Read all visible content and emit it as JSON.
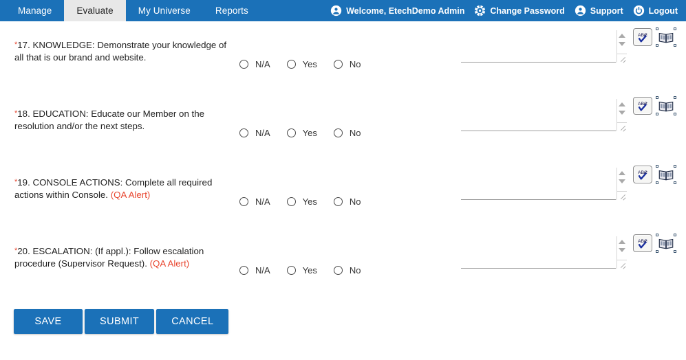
{
  "nav": {
    "tabs": [
      {
        "label": "Manage",
        "active": false
      },
      {
        "label": "Evaluate",
        "active": true
      },
      {
        "label": "My Universe",
        "active": false
      },
      {
        "label": "Reports",
        "active": false
      }
    ],
    "links": [
      {
        "label": "Welcome, EtechDemo Admin",
        "icon": "user-icon"
      },
      {
        "label": "Change Password",
        "icon": "gear-icon"
      },
      {
        "label": "Support",
        "icon": "user-icon"
      },
      {
        "label": "Logout",
        "icon": "power-icon"
      }
    ]
  },
  "colors": {
    "brand_blue": "#1b71b8",
    "active_tab_bg": "#e8e8e8",
    "alert_red": "#e8462f",
    "text": "#222222"
  },
  "questions": [
    {
      "required_marker": "*",
      "number": "17.",
      "title": "KNOWLEDGE:",
      "body": " Demonstrate your knowledge of all that is our brand and website.",
      "alert": "",
      "options": [
        "N/A",
        "Yes",
        "No"
      ],
      "selected": "",
      "comment": "",
      "comment_placeholder": ""
    },
    {
      "required_marker": "*",
      "number": "18.",
      "title": "EDUCATION:",
      "body": " Educate our Member on the resolution and/or the next steps.",
      "alert": "",
      "options": [
        "N/A",
        "Yes",
        "No"
      ],
      "selected": "",
      "comment": "",
      "comment_placeholder": ""
    },
    {
      "required_marker": "*",
      "number": "19.",
      "title": "CONSOLE ACTIONS:",
      "body": " Complete all required actions within Console. ",
      "alert": "(QA Alert)",
      "options": [
        "N/A",
        "Yes",
        "No"
      ],
      "selected": "",
      "comment": "",
      "comment_placeholder": ""
    },
    {
      "required_marker": "*",
      "number": "20.",
      "title": "ESCALATION:",
      "body": " (If appl.): Follow escalation procedure (Supervisor Request). ",
      "alert": "(QA Alert)",
      "options": [
        "N/A",
        "Yes",
        "No"
      ],
      "selected": "",
      "comment": "",
      "comment_placeholder": ""
    }
  ],
  "tools": {
    "spellcheck_label": "ABC",
    "spellcheck_name": "spellcheck-button",
    "dictionary_name": "dictionary-book-button"
  },
  "actions": [
    {
      "label": "SAVE",
      "name": "save-button"
    },
    {
      "label": "SUBMIT",
      "name": "submit-button"
    },
    {
      "label": "CANCEL",
      "name": "cancel-button"
    }
  ]
}
